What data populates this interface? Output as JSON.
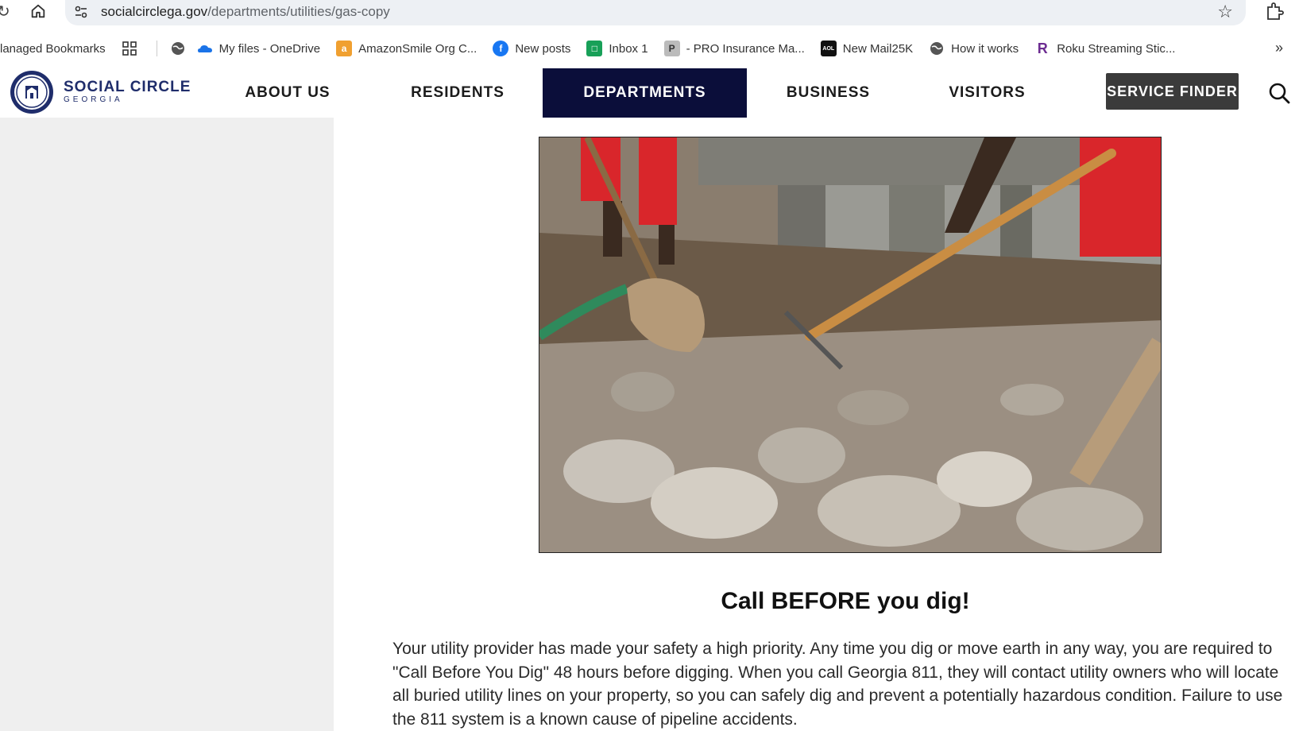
{
  "browser": {
    "url_domain": "socialcirclega.gov",
    "url_path": "/departments/utilities/gas-copy"
  },
  "bookmarks": {
    "items": [
      {
        "label": "lanaged Bookmarks",
        "icon": "folder-icon"
      },
      {
        "label": "",
        "icon": "apps-grid-icon"
      },
      {
        "label": "",
        "icon": "globe-icon"
      },
      {
        "label": "My files - OneDrive",
        "icon": "onedrive-cloud-icon"
      },
      {
        "label": "AmazonSmile Org C...",
        "icon": "amazon-icon"
      },
      {
        "label": "New posts",
        "icon": "facebook-icon"
      },
      {
        "label": "Inbox 1",
        "icon": "inbox-icon"
      },
      {
        "label": "- PRO Insurance Ma...",
        "icon": "pro-insurance-icon"
      },
      {
        "label": "New Mail25K",
        "icon": "aol-icon"
      },
      {
        "label": "How it works",
        "icon": "globe-icon"
      },
      {
        "label": "Roku Streaming Stic...",
        "icon": "roku-icon"
      }
    ],
    "more": "»"
  },
  "site": {
    "logo_line1": "SOCIAL CIRCLE",
    "logo_line2": "GEORGIA",
    "nav": [
      {
        "label": "ABOUT US"
      },
      {
        "label": "RESIDENTS"
      },
      {
        "label": "DEPARTMENTS",
        "active": true
      },
      {
        "label": "BUSINESS"
      },
      {
        "label": "VISITORS"
      }
    ],
    "service_finder": "SERVICE FINDER",
    "colors": {
      "brand_navy": "#1f2d6b",
      "active_nav_bg": "#0b0e3a",
      "service_finder_bg": "#3b3b3b"
    }
  },
  "content": {
    "heading": "Call BEFORE you dig!",
    "paragraph": "Your utility provider has made your safety a high priority. Any time you dig or move earth in any way, you are required to \"Call Before You Dig\" 48 hours before digging. When you call Georgia 811, they will contact utility owners who will locate all buried utility lines on your property, so you can safely dig and prevent a potentially hazardous condition. Failure to use the 811 system is a known cause of pipeline accidents."
  }
}
